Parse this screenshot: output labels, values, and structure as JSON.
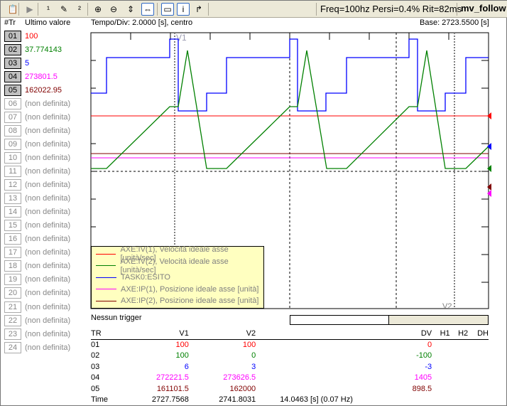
{
  "toolbar": {
    "icons": [
      "properties-icon",
      "play-icon",
      "trace-1-icon",
      "tools-icon",
      "trace-2-icon",
      "zoom-in-time-icon",
      "zoom-out-time-icon",
      "scale-vertical-icon",
      "scale-horizontal-icon",
      "window-icon",
      "info-icon",
      "export-icon"
    ],
    "status": "Freq=100hz Persi=0.4% Rit=82ms",
    "module": "mv_follow"
  },
  "header": {
    "tr": "#Tr",
    "last": "Ultimo valore",
    "timediv": "Tempo/Div: 2.0000 [s], centro",
    "base": "Base: 2723.5500 [s]"
  },
  "traces": [
    {
      "id": "01",
      "value": "100",
      "color": "#ff0000"
    },
    {
      "id": "02",
      "value": "37.774143",
      "color": "#008000"
    },
    {
      "id": "03",
      "value": "5",
      "color": "#0000ff"
    },
    {
      "id": "04",
      "value": "273801.5",
      "color": "#ff00ff"
    },
    {
      "id": "05",
      "value": "162022.95",
      "color": "#800000"
    },
    {
      "id": "06",
      "value": "(non definita)"
    },
    {
      "id": "07",
      "value": "(non definita)"
    },
    {
      "id": "08",
      "value": "(non definita)"
    },
    {
      "id": "09",
      "value": "(non definita)"
    },
    {
      "id": "10",
      "value": "(non definita)"
    },
    {
      "id": "11",
      "value": "(non definita)"
    },
    {
      "id": "12",
      "value": "(non definita)"
    },
    {
      "id": "13",
      "value": "(non definita)"
    },
    {
      "id": "14",
      "value": "(non definita)"
    },
    {
      "id": "15",
      "value": "(non definita)"
    },
    {
      "id": "16",
      "value": "(non definita)"
    },
    {
      "id": "17",
      "value": "(non definita)"
    },
    {
      "id": "18",
      "value": "(non definita)"
    },
    {
      "id": "19",
      "value": "(non definita)"
    },
    {
      "id": "20",
      "value": "(non definita)"
    },
    {
      "id": "21",
      "value": "(non definita)"
    },
    {
      "id": "22",
      "value": "(non definita)"
    },
    {
      "id": "23",
      "value": "(non definita)"
    },
    {
      "id": "24",
      "value": "(non definita)"
    }
  ],
  "cursors": {
    "v1": "V1",
    "v2": "V2"
  },
  "legend": [
    {
      "label": "AXE:IV(1), Velocità ideale asse [unità/sec]",
      "color": "#ff0000"
    },
    {
      "label": "AXE:IV(2), Velocità ideale asse [unità/sec]",
      "color": "#008000"
    },
    {
      "label": "TASK0:ESITO",
      "color": "#0000ff"
    },
    {
      "label": "AXE:IP(1), Posizione ideale asse [unità]",
      "color": "#ff00ff"
    },
    {
      "label": "AXE:IP(2), Posizione ideale asse [unità]",
      "color": "#800000"
    }
  ],
  "trigger": "Nessun trigger",
  "scroll_position": 0.5,
  "table": {
    "headers": [
      "TR",
      "V1",
      "V2",
      "DV",
      "H1",
      "H2",
      "DH"
    ],
    "rows": [
      {
        "c": [
          "01",
          "100",
          "100",
          "0",
          "",
          "",
          ""
        ],
        "color": "#ff0000"
      },
      {
        "c": [
          "02",
          "100",
          "0",
          "-100",
          "",
          "",
          ""
        ],
        "color": "#008000"
      },
      {
        "c": [
          "03",
          "6",
          "3",
          "-3",
          "",
          "",
          ""
        ],
        "color": "#0000ff"
      },
      {
        "c": [
          "04",
          "272221.5",
          "273626.5",
          "1405",
          "",
          "",
          ""
        ],
        "color": "#ff00ff"
      },
      {
        "c": [
          "05",
          "161101.5",
          "162000",
          "898.5",
          "",
          "",
          ""
        ],
        "color": "#800000"
      },
      {
        "c": [
          "Time",
          "2727.7568",
          "2741.8031",
          "14.0463 [s] (0.07  Hz)",
          "",
          "",
          ""
        ],
        "color": "#000000"
      }
    ]
  }
}
